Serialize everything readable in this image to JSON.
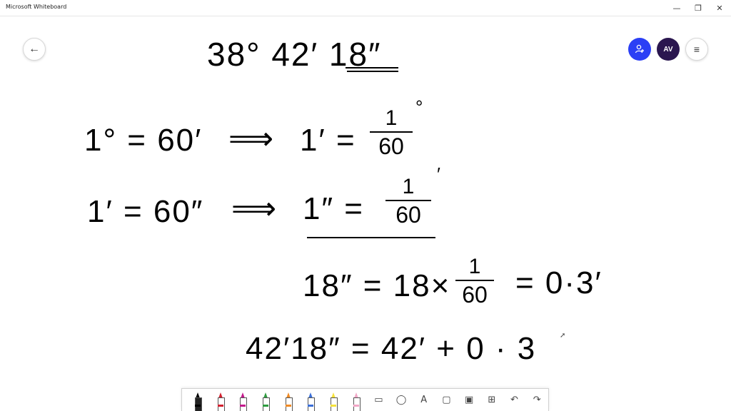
{
  "window": {
    "title": "Microsoft Whiteboard",
    "minimize": "—",
    "restore": "❐",
    "close": "✕"
  },
  "nav": {
    "back_icon": "←",
    "share_icon": "person-icon",
    "avatar_initials": "AV",
    "menu_icon": "≡"
  },
  "board": {
    "angle": "38° 42′ 18″",
    "line1_lhs": "1° = 60′",
    "line1_arrow": "⟹",
    "line1_rhs": "1′ =",
    "line1_num": "1",
    "line1_den": "60",
    "line1_unit": "°",
    "line2_lhs": "1′ = 60″",
    "line2_arrow": "⟹",
    "line2_rhs": "1″ =",
    "line2_num": "1",
    "line2_den": "60",
    "line2_unit": "′",
    "line3_lhs": "18″ =  18×",
    "line3_num": "1",
    "line3_den": "60",
    "line3_rhs": "= 0·3′",
    "line4": "42′18″ =  42′ + 0 · 3"
  },
  "toolbar": {
    "tools": [
      {
        "name": "pen-black",
        "color": "#000000"
      },
      {
        "name": "pen-red",
        "color": "#d3202f"
      },
      {
        "name": "pen-magenta",
        "color": "#c2188b"
      },
      {
        "name": "pen-green",
        "color": "#2e9b3f"
      },
      {
        "name": "pen-rainbow",
        "color": "#f08a24"
      },
      {
        "name": "pen-galaxy",
        "color": "#3a6fd8"
      },
      {
        "name": "highlighter-yellow",
        "color": "#f6e23a"
      },
      {
        "name": "eraser",
        "color": "#f1a6c6"
      }
    ],
    "ruler_icon": "▭",
    "lasso_icon": "◯",
    "text_icon": "A",
    "note_icon": "▢",
    "image_icon": "▣",
    "insert_icon": "⊞",
    "undo_icon": "↶",
    "redo_icon": "↷"
  }
}
